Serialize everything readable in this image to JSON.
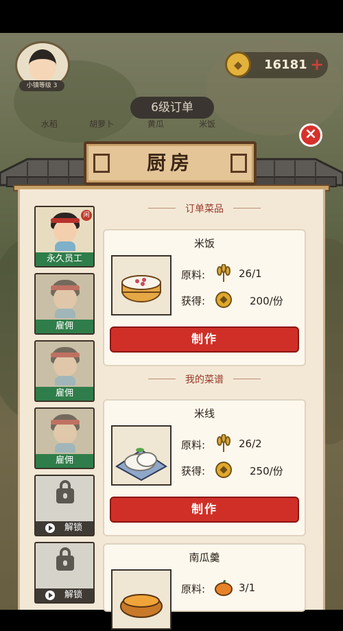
{
  "hud": {
    "level_tag": "小镇等级 3",
    "coins": "16181",
    "coin_plus": "+"
  },
  "order": {
    "title": "6级订单",
    "tabs": [
      "水稻",
      "胡萝卜",
      "黄瓜",
      "米饭"
    ]
  },
  "kitchen": {
    "title": "厨房",
    "close": "×",
    "staff": [
      {
        "label": "永久员工",
        "badge": "闲"
      },
      {
        "label": "雇佣"
      },
      {
        "label": "雇佣"
      },
      {
        "label": "雇佣"
      }
    ],
    "locked_slots": [
      {
        "label": "解锁"
      },
      {
        "label": "解锁"
      }
    ],
    "sections": {
      "orders": "订单菜品",
      "recipes": "我的菜谱"
    },
    "labels": {
      "ingredients": "原料:",
      "earn": "获得:"
    },
    "dishes": [
      {
        "name": "米饭",
        "ingredient_icon": "rice-plant-icon",
        "ingredients": "26/1",
        "reward": "200/份",
        "button": "制作"
      },
      {
        "name": "米线",
        "ingredient_icon": "rice-plant-icon",
        "ingredients": "26/2",
        "reward": "250/份",
        "button": "制作"
      },
      {
        "name": "南瓜羹",
        "ingredient_icon": "pumpkin-icon",
        "ingredients": "3/1",
        "reward": "",
        "button": ""
      }
    ]
  },
  "colors": {
    "accent_red": "#cf2f27",
    "staff_green": "#2f7d4a",
    "panel_bg": "#f3e8d6"
  }
}
